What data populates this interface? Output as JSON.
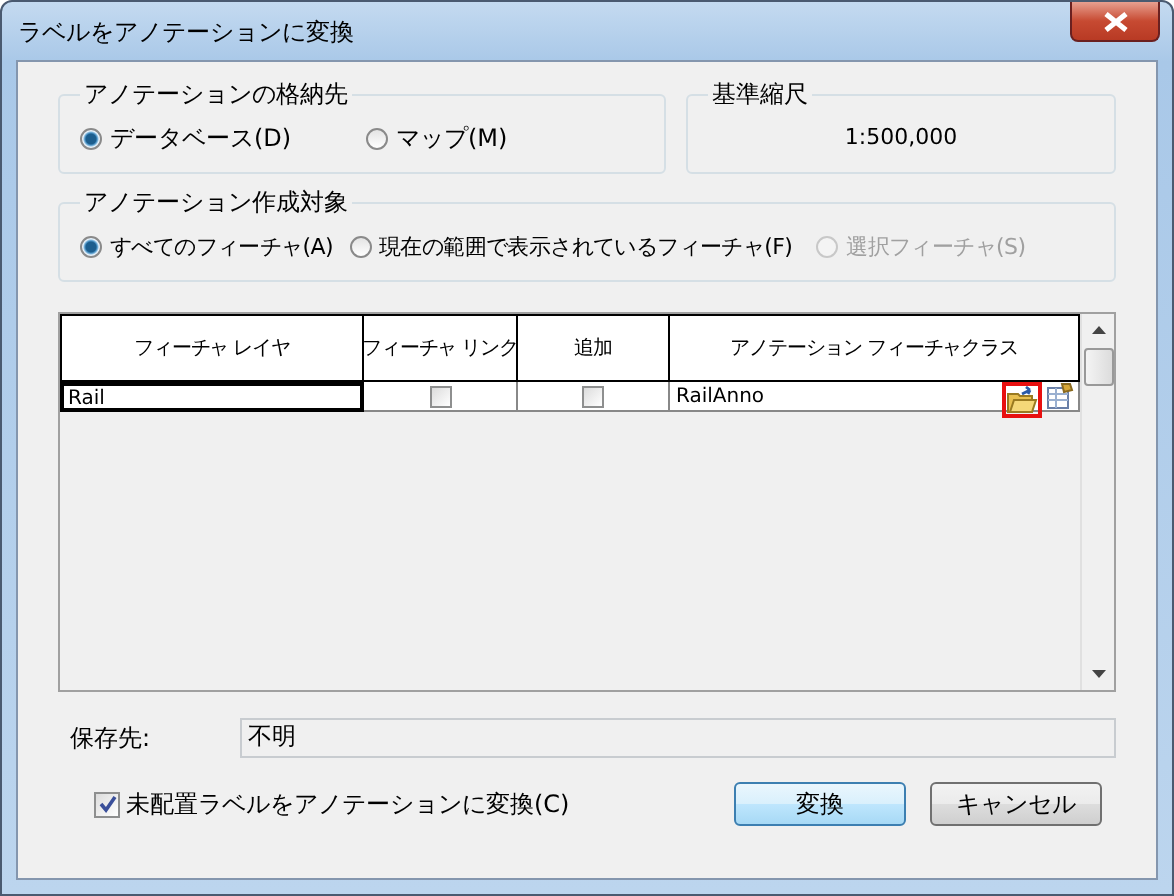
{
  "window": {
    "title": "ラベルをアノテーションに変換"
  },
  "storage": {
    "title": "アノテーションの格納先",
    "options": [
      {
        "label": "データベース(D)",
        "selected": true
      },
      {
        "label": "マップ(M)",
        "selected": false
      }
    ]
  },
  "reference_scale": {
    "title": "基準縮尺",
    "value": "1:500,000"
  },
  "target": {
    "title": "アノテーション作成対象",
    "options": [
      {
        "label": "すべてのフィーチャ(A)",
        "selected": true,
        "disabled": false
      },
      {
        "label": "現在の範囲で表示されているフィーチャ(F)",
        "selected": false,
        "disabled": false
      },
      {
        "label": "選択フィーチャ(S)",
        "selected": false,
        "disabled": true
      }
    ]
  },
  "table": {
    "columns": [
      "フィーチャ レイヤ",
      "フィーチャ リンク",
      "追加",
      "アノテーション フィーチャクラス"
    ],
    "rows": [
      {
        "layer": "Rail",
        "feature_link": false,
        "append": false,
        "annotation_class": "RailAnno",
        "browse_highlighted": true
      }
    ]
  },
  "save_to": {
    "label": "保存先:",
    "value": "不明"
  },
  "convert_unplaced": {
    "label": "未配置ラベルをアノテーションに変換(C)",
    "checked": true
  },
  "buttons": [
    {
      "label": "変換",
      "default": true
    },
    {
      "label": "キャンセル",
      "default": false
    }
  ]
}
